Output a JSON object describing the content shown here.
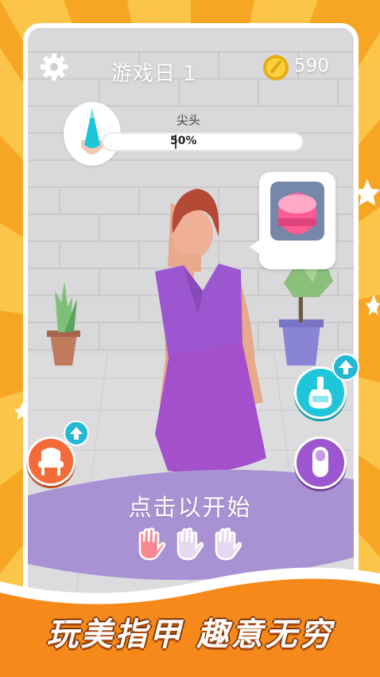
{
  "hud": {
    "settings_icon": "gear-icon",
    "title": "游戏日 1",
    "coin_icon": "coin-icon",
    "coins": "590"
  },
  "progress": {
    "label": "尖头",
    "percent_text": "50%",
    "value": 0.5
  },
  "speech_bubble": {
    "icon": "nail-polish-jar-icon"
  },
  "buttons": {
    "chair": {
      "icon": "chair-icon",
      "badge": "up-arrow-icon"
    },
    "polish": {
      "icon": "nail-polish-bottle-icon",
      "badge": "up-arrow-icon"
    },
    "nail": {
      "icon": "finger-nail-icon"
    }
  },
  "tap_prompt": "点击以开始",
  "hands": {
    "total": 3,
    "active": 1
  },
  "slogan": "玩美指甲 趣意无穷",
  "colors": {
    "background_orange": "#f6a21c",
    "accent_cyan": "#1fc6d9",
    "accent_purple": "#9b56d0",
    "panel_purple": "#a892d4",
    "hand_active": "#f5898f",
    "hand_inactive": "#e5d9f2"
  }
}
